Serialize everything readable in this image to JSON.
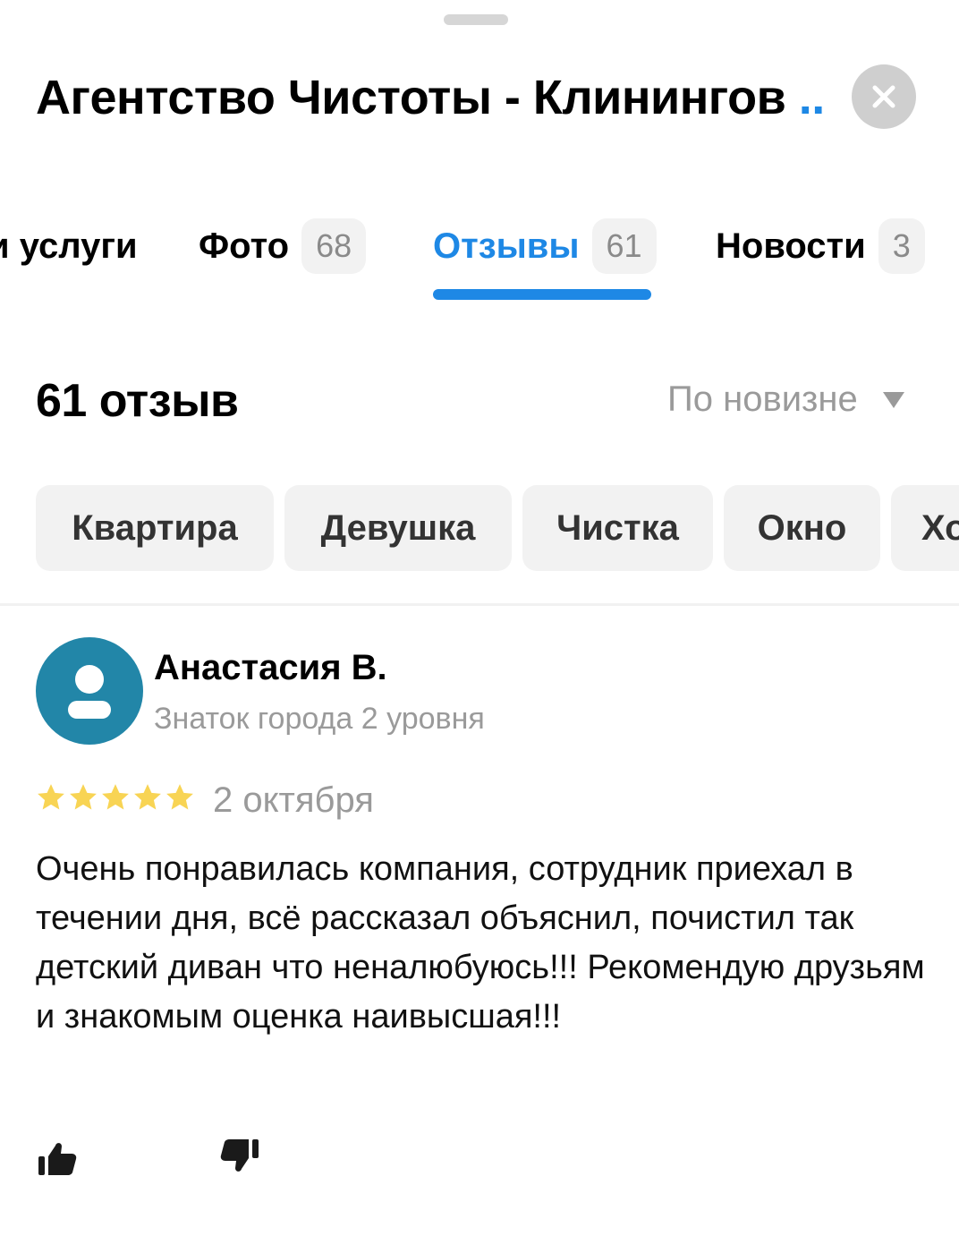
{
  "header": {
    "title": "Агентство Чистоты - Клинингов",
    "title_ellipsis": "...",
    "close_label": "×"
  },
  "tabs": [
    {
      "label": "и услуги",
      "count": ""
    },
    {
      "label": "Фото",
      "count": "68"
    },
    {
      "label": "Отзывы",
      "count": "61",
      "active": true
    },
    {
      "label": "Новости",
      "count": "3"
    }
  ],
  "reviews_header": {
    "count_title": "61 отзыв",
    "sort_label": "По новизне"
  },
  "chips": [
    "Квартира",
    "Девушка",
    "Чистка",
    "Окно",
    "Хо"
  ],
  "review": {
    "author": "Анастасия В.",
    "level": "Знаток города 2 уровня",
    "rating": 5,
    "date": "2 октября",
    "text": "Очень понравилась компания, сотрудник приехал в течении дня, всё рассказал объяснил, почистил так детский диван что неналюбуюсь!!! Рекомендую друзьям и знакомым оценка наивысшая!!!"
  },
  "colors": {
    "accent": "#1e88e5",
    "star": "#f8d454",
    "avatar_bg": "#2286a8"
  },
  "icons": [
    "close-icon",
    "chevron-down-icon",
    "user-icon",
    "star-icon",
    "thumbs-up-icon",
    "thumbs-down-icon"
  ]
}
